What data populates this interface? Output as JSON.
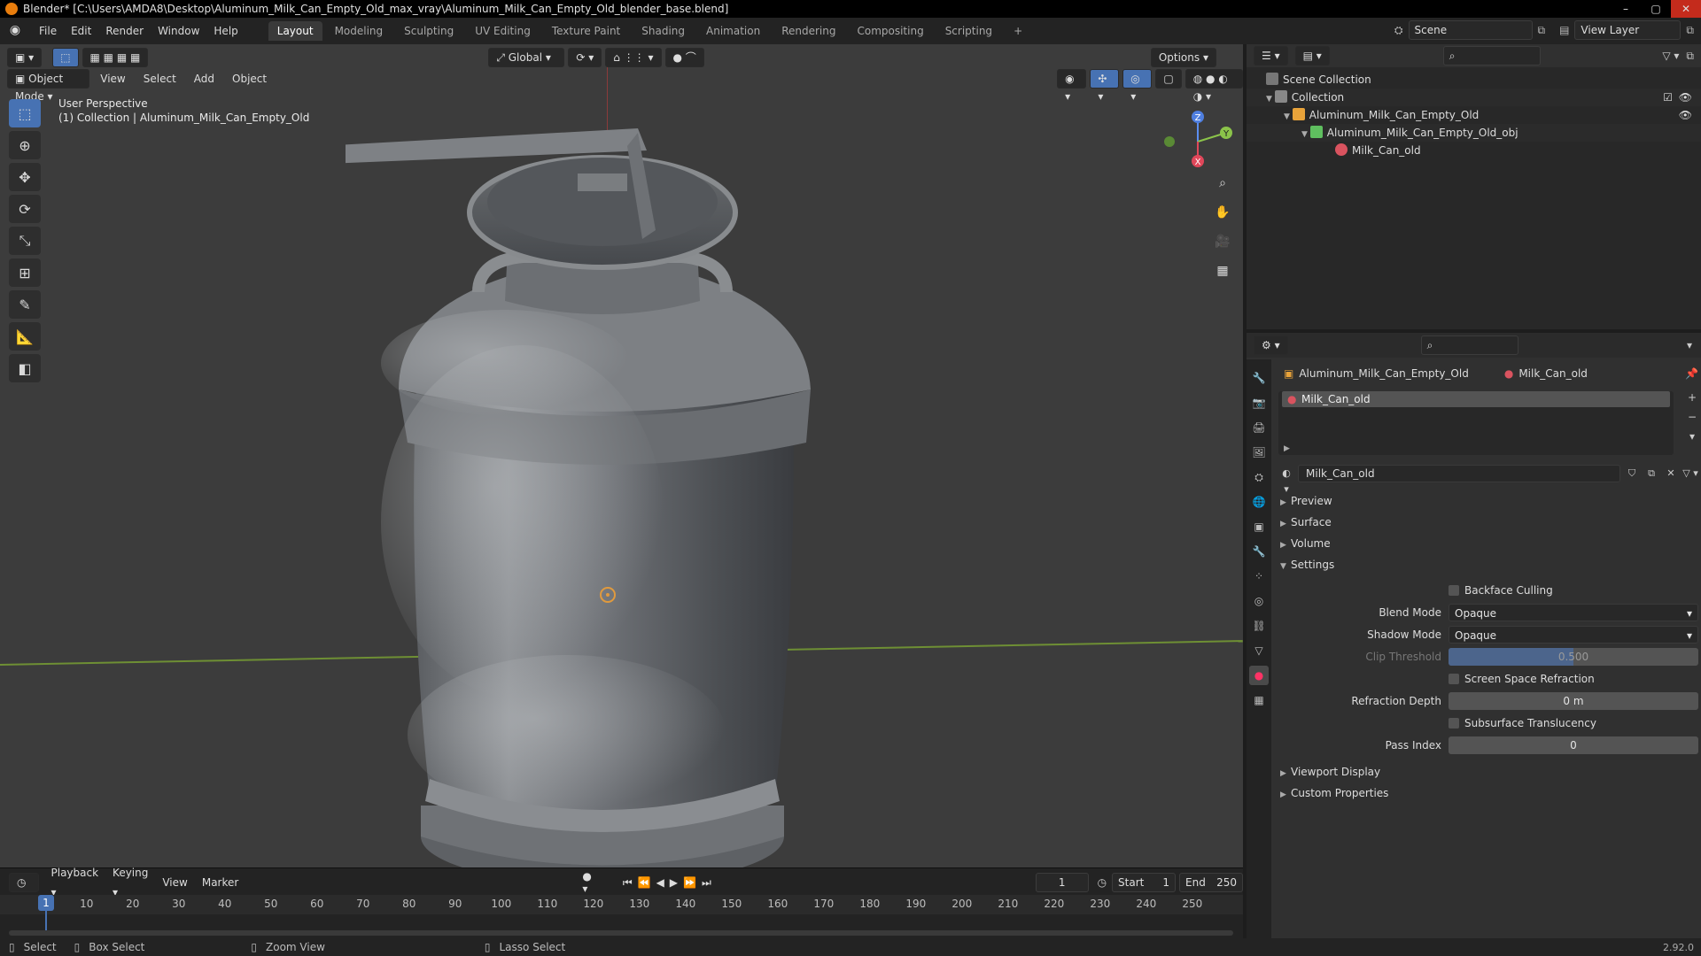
{
  "window": {
    "title": "Blender* [C:\\Users\\AMDA8\\Desktop\\Aluminum_Milk_Can_Empty_Old_max_vray\\Aluminum_Milk_Can_Empty_Old_blender_base.blend]"
  },
  "menubar": {
    "menus": [
      "File",
      "Edit",
      "Render",
      "Window",
      "Help"
    ],
    "workspaces": [
      "Layout",
      "Modeling",
      "Sculpting",
      "UV Editing",
      "Texture Paint",
      "Shading",
      "Animation",
      "Rendering",
      "Compositing",
      "Scripting"
    ],
    "active_workspace": "Layout",
    "scene": "Scene",
    "view_layer": "View Layer"
  },
  "viewport": {
    "mode": "Object Mode",
    "menus": [
      "View",
      "Select",
      "Add",
      "Object"
    ],
    "transform_orientation": "Global",
    "options_label": "Options",
    "perspective_label": "User Perspective",
    "collection_label": "(1) Collection | Aluminum_Milk_Can_Empty_Old",
    "gizmo_axes": [
      "Z",
      "Y",
      "X"
    ]
  },
  "timeline": {
    "menus": [
      "Playback",
      "Keying",
      "View",
      "Marker"
    ],
    "current_frame": "1",
    "start_label": "Start",
    "start": "1",
    "end_label": "End",
    "end": "250",
    "ruler": [
      "1",
      "10",
      "20",
      "30",
      "40",
      "50",
      "60",
      "70",
      "80",
      "90",
      "100",
      "110",
      "120",
      "130",
      "140",
      "150",
      "160",
      "170",
      "180",
      "190",
      "200",
      "210",
      "220",
      "230",
      "240",
      "250"
    ]
  },
  "statusbar": {
    "select": "Select",
    "box_select": "Box Select",
    "zoom_view": "Zoom View",
    "lasso_select": "Lasso Select",
    "version": "2.92.0"
  },
  "outliner": {
    "scene_collection": "Scene Collection",
    "collection": "Collection",
    "object": "Aluminum_Milk_Can_Empty_Old",
    "mesh": "Aluminum_Milk_Can_Empty_Old_obj",
    "material": "Milk_Can_old"
  },
  "properties": {
    "breadcrumb_object": "Aluminum_Milk_Can_Empty_Old",
    "breadcrumb_material": "Milk_Can_old",
    "slot_name": "Milk_Can_old",
    "material_name": "Milk_Can_old",
    "panels": {
      "preview": "Preview",
      "surface": "Surface",
      "volume": "Volume",
      "settings": "Settings",
      "viewport_display": "Viewport Display",
      "custom_properties": "Custom Properties"
    },
    "settings": {
      "backface_culling": "Backface Culling",
      "blend_mode_label": "Blend Mode",
      "blend_mode": "Opaque",
      "shadow_mode_label": "Shadow Mode",
      "shadow_mode": "Opaque",
      "clip_threshold_label": "Clip Threshold",
      "clip_threshold": "0.500",
      "clip_threshold_fraction": 0.5,
      "screen_space_refraction": "Screen Space Refraction",
      "refraction_depth_label": "Refraction Depth",
      "refraction_depth": "0 m",
      "subsurface_translucency": "Subsurface Translucency",
      "pass_index_label": "Pass Index",
      "pass_index": "0"
    }
  }
}
